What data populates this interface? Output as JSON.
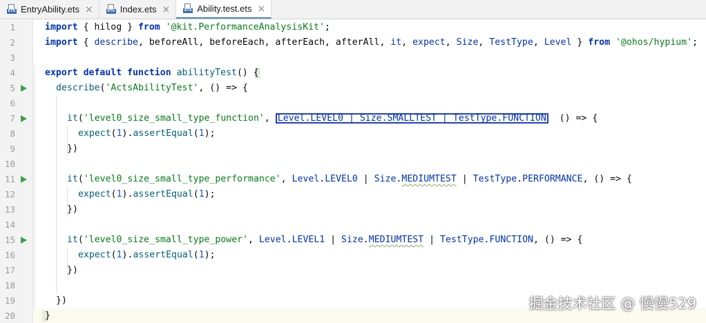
{
  "tabs": [
    {
      "icon": "ets-file-icon",
      "badge": "ETS",
      "label": "EntryAbility.ets",
      "close": "×",
      "active": false
    },
    {
      "icon": "ets-file-icon",
      "badge": "ETS",
      "label": "Index.ets",
      "close": "×",
      "active": false
    },
    {
      "icon": "ets-file-icon",
      "badge": "ETS",
      "label": "Ability.test.ets",
      "close": "×",
      "active": true
    }
  ],
  "line_numbers": [
    "1",
    "2",
    "3",
    "4",
    "5",
    "6",
    "7",
    "8",
    "9",
    "10",
    "11",
    "12",
    "13",
    "14",
    "15",
    "16",
    "17",
    "18",
    "19",
    "20"
  ],
  "run_gutter_lines": [
    5,
    7,
    11,
    15
  ],
  "code": {
    "l1": {
      "t1": "import",
      "t2": " { hilog } ",
      "t3": "from",
      "t4": " ",
      "t5": "'@kit.PerformanceAnalysisKit'",
      "t6": ";"
    },
    "l2": {
      "t1": "import",
      "t2": " { ",
      "t3": "describe",
      "t4": ", ",
      "t5": "beforeAll",
      "t6": ", ",
      "t7": "beforeEach",
      "t8": ", ",
      "t9": "afterEach",
      "t10": ", ",
      "t11": "afterAll",
      "t12": ", ",
      "t13": "it",
      "t14": ", ",
      "t15": "expect",
      "t16": ", ",
      "t17": "Size",
      "t18": ", ",
      "t19": "TestType",
      "t20": ", ",
      "t21": "Level",
      "t22": " } ",
      "t23": "from",
      "t24": " ",
      "t25": "'@ohos/hypium'",
      "t26": ";"
    },
    "l4": {
      "t1": "export",
      "t2": " ",
      "t3": "default",
      "t4": " ",
      "t5": "function",
      "t6": " ",
      "t7": "abilityTest",
      "t8": "() {"
    },
    "l5": {
      "t1": "describe",
      "t2": "(",
      "t3": "'ActsAbilityTest'",
      "t4": ", () => {"
    },
    "l7": {
      "t1": "it",
      "t2": "(",
      "t3": "'level0_size_small_type_function'",
      "t4": ", ",
      "t5": "Level.LEVEL0 | Size.SMALLTEST | TestType.FUNCTION",
      "t6": "  () => {"
    },
    "l8": {
      "t1": "expect",
      "t2": "(",
      "t3": "1",
      "t4": ").",
      "t5": "assertEqual",
      "t6": "(",
      "t7": "1",
      "t8": ");"
    },
    "l9": {
      "t1": "})"
    },
    "l11": {
      "t1": "it",
      "t2": "(",
      "t3": "'level0_size_small_type_performance'",
      "t4": ", ",
      "t5": "Level",
      "t6": ".",
      "t7": "LEVEL0",
      "t8": " | ",
      "t9": "Size",
      "t10": ".",
      "t11": "MEDIUMTEST",
      "t12": " | ",
      "t13": "TestType",
      "t14": ".",
      "t15": "PERFORMANCE",
      "t16": ", () => {"
    },
    "l12": {
      "t1": "expect",
      "t2": "(",
      "t3": "1",
      "t4": ").",
      "t5": "assertEqual",
      "t6": "(",
      "t7": "1",
      "t8": ");"
    },
    "l13": {
      "t1": "})"
    },
    "l15": {
      "t1": "it",
      "t2": "(",
      "t3": "'level0_size_small_type_power'",
      "t4": ", ",
      "t5": "Level",
      "t6": ".",
      "t7": "LEVEL1",
      "t8": " | ",
      "t9": "Size",
      "t10": ".",
      "t11": "MEDIUMTEST",
      "t12": " | ",
      "t13": "TestType",
      "t14": ".",
      "t15": "FUNCTION",
      "t16": ", () => {"
    },
    "l16": {
      "t1": "expect",
      "t2": "(",
      "t3": "1",
      "t4": ").",
      "t5": "assertEqual",
      "t6": "(",
      "t7": "1",
      "t8": ");"
    },
    "l17": {
      "t1": "})"
    },
    "l19": {
      "t1": "})"
    },
    "l20": {
      "t1": "}"
    }
  },
  "watermark": "掘金技术社区 @ 慢慢529",
  "colors": {
    "keyword": "#0033b3",
    "string": "#067d17",
    "function": "#00627a",
    "number": "#1750eb",
    "highlight_box": "#1e3fcf",
    "run_icon": "#3aa04a"
  }
}
